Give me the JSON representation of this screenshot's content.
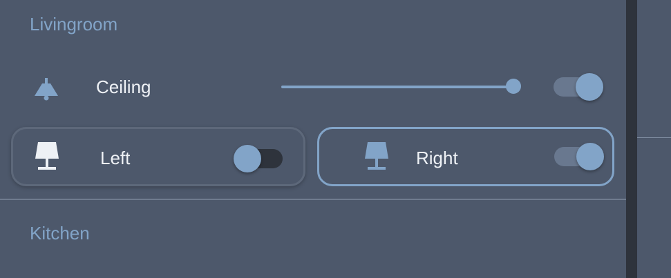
{
  "sections": [
    {
      "title": "Livingroom"
    },
    {
      "title": "Kitchen"
    }
  ],
  "livingroom": {
    "ceiling": {
      "label": "Ceiling",
      "icon": "ceiling-lamp-icon",
      "brightness": 0.99,
      "on": true
    },
    "left": {
      "label": "Left",
      "icon": "table-lamp-icon",
      "on": false
    },
    "right": {
      "label": "Right",
      "icon": "table-lamp-icon",
      "on": true
    }
  },
  "colors": {
    "background": "#4d586b",
    "accent": "#82a4c8",
    "text": "#eef1f5",
    "track_off": "#2e333c",
    "track_on": "#69788f"
  }
}
